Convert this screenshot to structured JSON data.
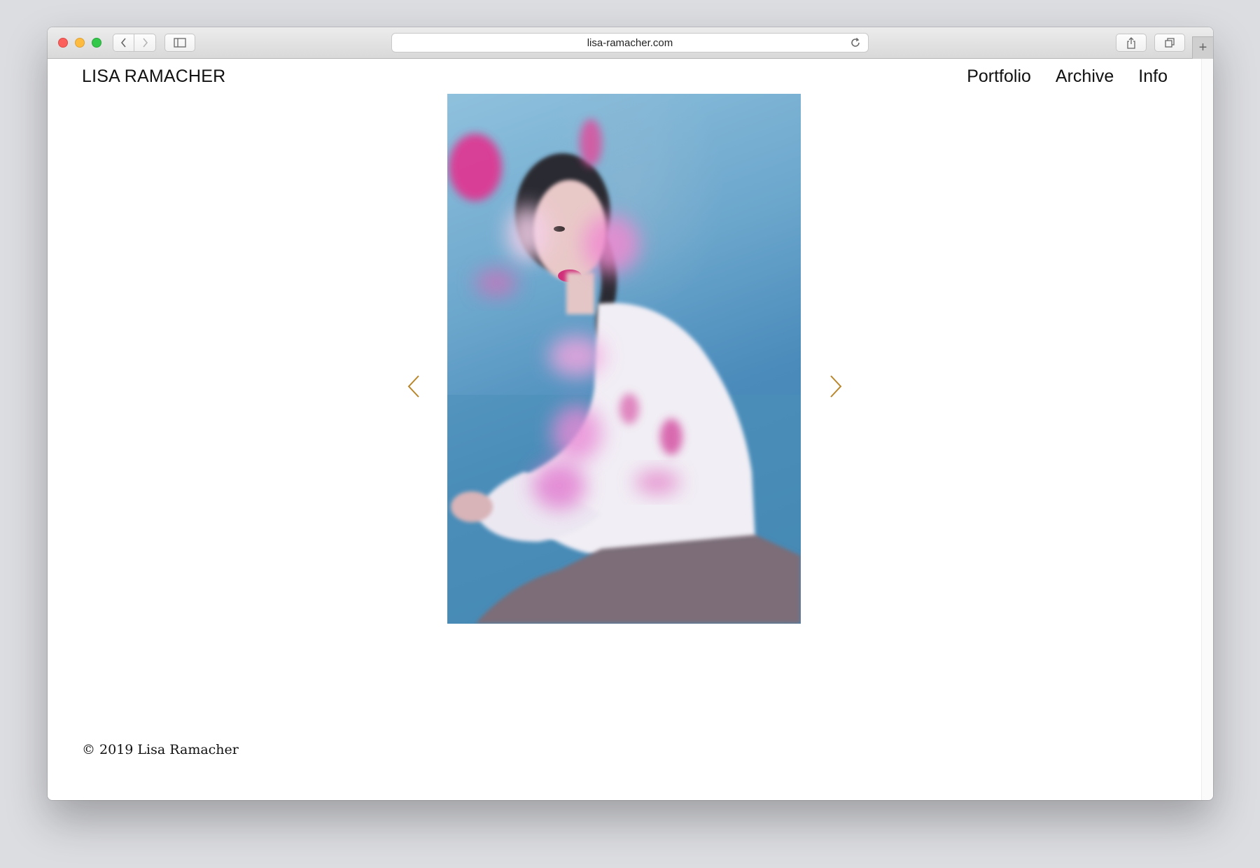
{
  "browser": {
    "url": "lisa-ramacher.com",
    "icons": [
      "back-chevron-icon",
      "forward-chevron-icon",
      "sidebar-icon",
      "reload-icon",
      "share-icon",
      "tabs-icon",
      "plus-icon"
    ]
  },
  "site": {
    "brand": "LISA RAMACHER",
    "nav": [
      {
        "label": "Portfolio"
      },
      {
        "label": "Archive"
      },
      {
        "label": "Info"
      }
    ],
    "footer": "© 2019 Lisa Ramacher"
  },
  "gallery": {
    "accent_color": "#b8862b",
    "image_subject": "portrait of a woman in a white blouse with pink petals, blue background"
  }
}
